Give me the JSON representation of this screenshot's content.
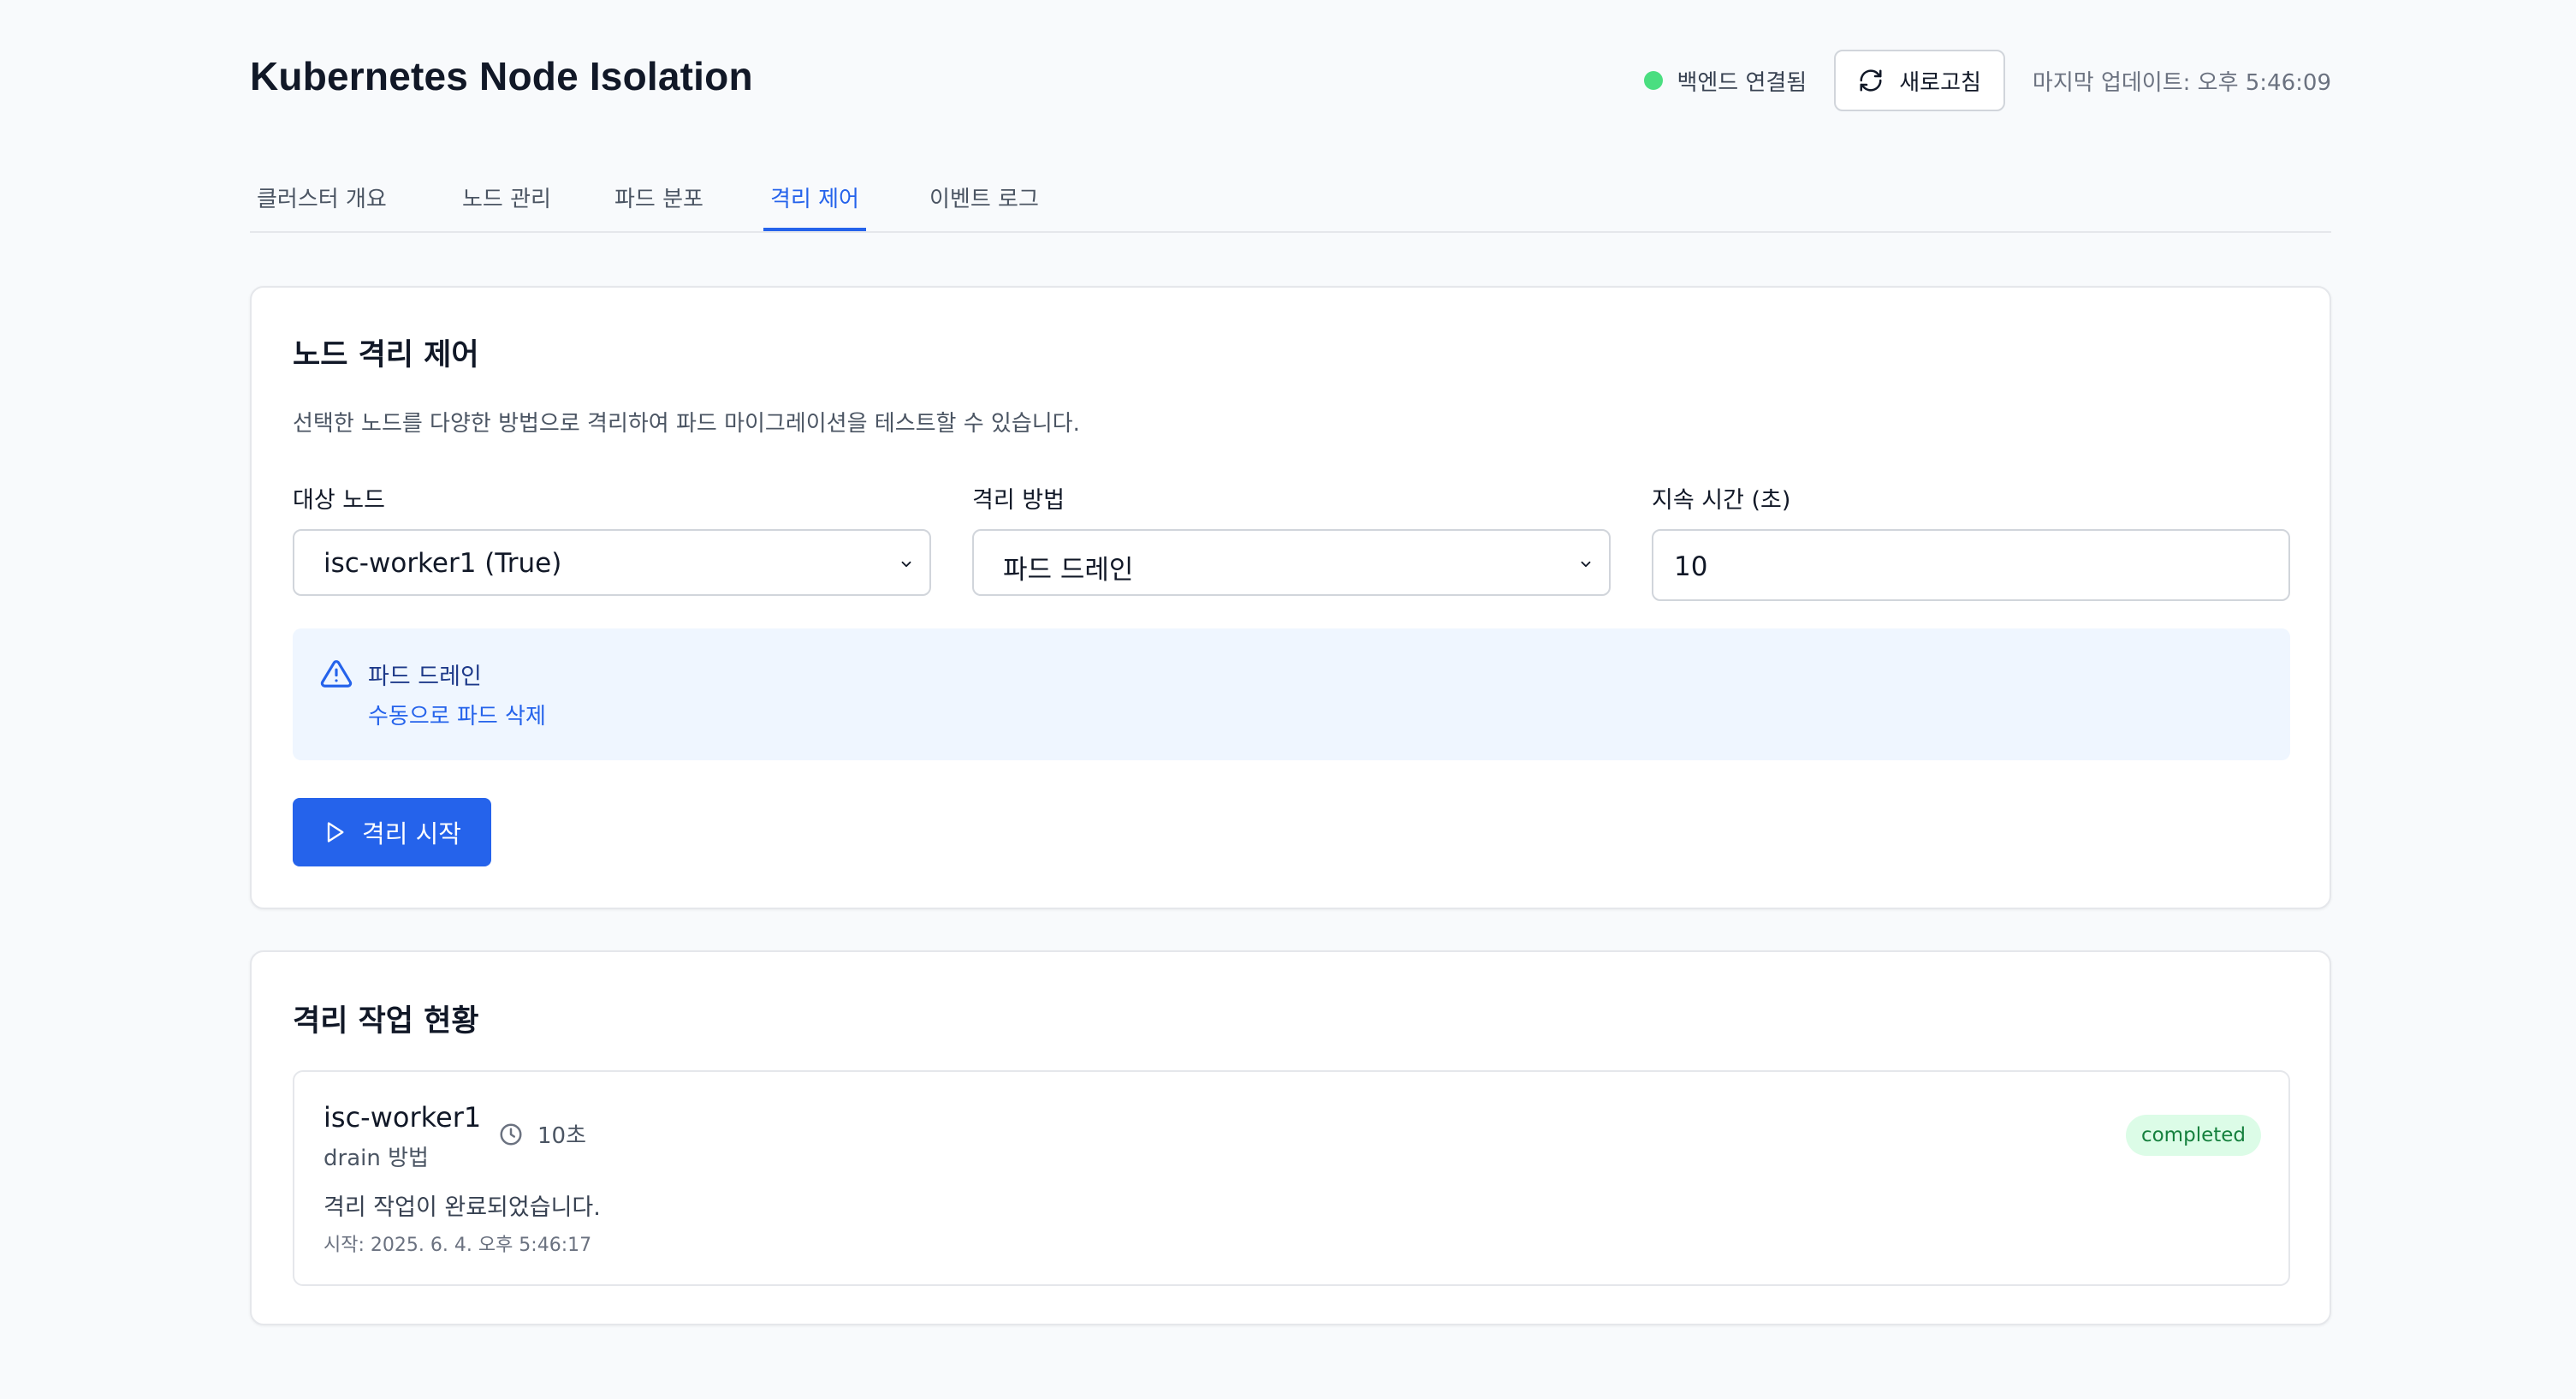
{
  "header": {
    "title": "Kubernetes Node Isolation",
    "backend_status": "백엔드 연결됨",
    "refresh_label": "새로고침",
    "last_update": "마지막 업데이트: 오후 5:46:09",
    "status_color": "#4ade80"
  },
  "tabs": [
    {
      "label": "클러스터 개요",
      "active": false
    },
    {
      "label": "노드 관리",
      "active": false
    },
    {
      "label": "파드 분포",
      "active": false
    },
    {
      "label": "격리 제어",
      "active": true
    },
    {
      "label": "이벤트 로그",
      "active": false
    }
  ],
  "control": {
    "title": "노드 격리 제어",
    "description": "선택한 노드를 다양한 방법으로 격리하여 파드 마이그레이션을 테스트할 수 있습니다.",
    "target_node": {
      "label": "대상 노드",
      "value": "isc-worker1 (True)"
    },
    "method": {
      "label": "격리 방법",
      "value": "파드 드레인"
    },
    "duration": {
      "label": "지속 시간 (초)",
      "value": "10"
    },
    "alert": {
      "title": "파드 드레인",
      "description": "수동으로 파드 삭제",
      "icon": "warning-triangle-icon"
    },
    "start_label": "격리 시작",
    "accent_color": "#2563eb"
  },
  "status_section": {
    "title": "격리 작업 현황",
    "jobs": [
      {
        "node": "isc-worker1",
        "method": "drain 방법",
        "duration": "10초",
        "message": "격리 작업이 완료되었습니다.",
        "started": "시작: 2025. 6. 4. 오후 5:46:17",
        "status": "completed",
        "status_color": "#15803d"
      }
    ]
  }
}
